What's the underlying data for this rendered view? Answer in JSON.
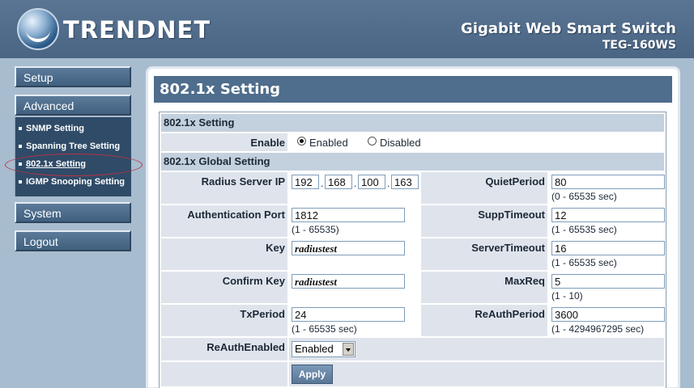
{
  "header": {
    "brand": "TRENDNET",
    "product_title": "Gigabit Web Smart Switch",
    "product_model": "TEG-160WS"
  },
  "sidebar": {
    "setup": "Setup",
    "advanced": "Advanced",
    "advanced_items": [
      "SNMP Setting",
      "Spanning Tree Setting",
      "802.1x Setting",
      "IGMP Snooping Setting"
    ],
    "system": "System",
    "logout": "Logout"
  },
  "page": {
    "title": "802.1x Setting"
  },
  "form": {
    "section1": "802.1x Setting",
    "enable_label": "Enable",
    "enabled_label": "Enabled",
    "disabled_label": "Disabled",
    "selected_enable": "Enabled",
    "section2": "802.1x Global Setting",
    "radius_ip_label": "Radius Server IP",
    "radius_ip": [
      "192",
      "168",
      "100",
      "163"
    ],
    "auth_port_label": "Authentication Port",
    "auth_port": "1812",
    "auth_port_range": "(1 - 65535)",
    "key_label": "Key",
    "key": "radiustest",
    "confirm_key_label": "Confirm Key",
    "confirm_key": "radiustest",
    "txperiod_label": "TxPeriod",
    "txperiod": "24",
    "txperiod_range": "(1 - 65535 sec)",
    "reauthenabled_label": "ReAuthEnabled",
    "reauthenabled": "Enabled",
    "quietperiod_label": "QuietPeriod",
    "quietperiod": "80",
    "quietperiod_range": "(0 - 65535 sec)",
    "supptimeout_label": "SuppTimeout",
    "supptimeout": "12",
    "supptimeout_range": "(1 - 65535 sec)",
    "servertimeout_label": "ServerTimeout",
    "servertimeout": "16",
    "servertimeout_range": "(1 - 65535 sec)",
    "maxreq_label": "MaxReq",
    "maxreq": "5",
    "maxreq_range": "(1 - 10)",
    "reauthperiod_label": "ReAuthPeriod",
    "reauthperiod": "3600",
    "reauthperiod_range": "(1 - 4294967295 sec)",
    "apply_label": "Apply"
  },
  "colors": {
    "header_bg": "#4a6584",
    "sidebar_bg": "#a8bccf",
    "title_bar": "#4f6d8c",
    "section_bar": "#c3d0de",
    "label_cell": "#dfe4ec"
  }
}
